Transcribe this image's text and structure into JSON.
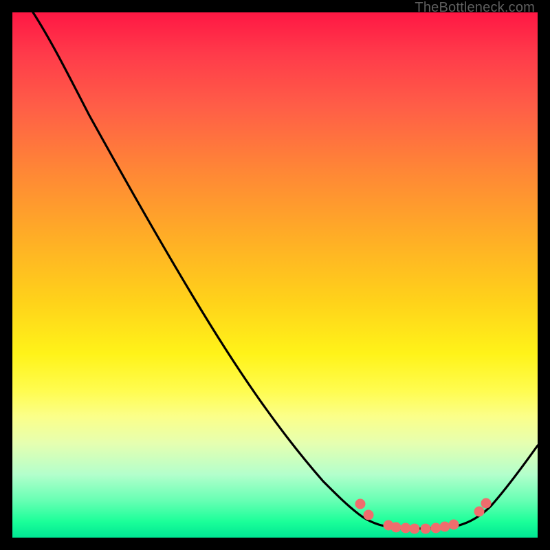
{
  "watermark": "TheBottleneck.com",
  "chart_data": {
    "type": "line",
    "title": "",
    "xlabel": "",
    "ylabel": "",
    "xlim": [
      0,
      100
    ],
    "ylim": [
      0,
      100
    ],
    "background": "gradient-red-to-green-vertical",
    "series": [
      {
        "name": "bottleneck-curve",
        "x": [
          4,
          10,
          18,
          26,
          34,
          42,
          50,
          58,
          63,
          67,
          71,
          75,
          79,
          83,
          87,
          90,
          93,
          98
        ],
        "y": [
          100,
          92,
          80,
          67,
          54,
          41,
          28,
          15,
          8,
          4,
          2,
          1,
          1,
          1,
          2,
          5,
          10,
          18
        ]
      }
    ],
    "markers": {
      "name": "optimal-range-dots",
      "x": [
        66,
        68,
        72,
        73,
        75,
        77,
        79,
        81,
        82,
        84,
        88,
        90
      ],
      "y": [
        6,
        4,
        2,
        1.6,
        1.4,
        1.2,
        1.2,
        1.3,
        1.6,
        2,
        4.5,
        6
      ]
    },
    "colors": {
      "curve": "#000000",
      "markers": "#ef6d6d",
      "gradient_top": "#ff1744",
      "gradient_bottom": "#00e693"
    }
  }
}
